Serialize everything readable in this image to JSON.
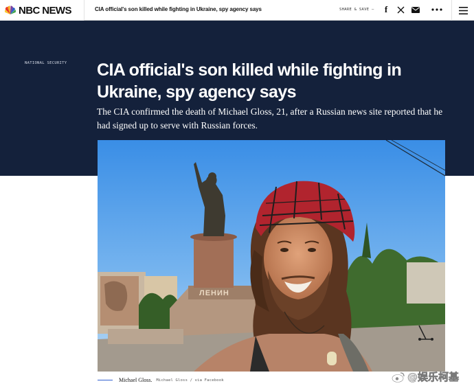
{
  "nav": {
    "logo_text": "NBC NEWS",
    "headline": "CIA official's son killed while fighting in Ukraine, spy agency says",
    "share_label": "SHARE & SAVE —",
    "icons": [
      "facebook-icon",
      "x-icon",
      "mail-icon",
      "more-icon",
      "menu-icon"
    ]
  },
  "article": {
    "section": "NATIONAL SECURITY",
    "headline": "CIA official's son killed while fighting in Ukraine, spy agency says",
    "dek": "The CIA confirmed the death of Michael Gloss, 21, after a Russian news site reported that he had signed up to serve with Russian forces."
  },
  "photo": {
    "monument_inscription": "ЛЕНИН",
    "caption": "Michael Gloss.",
    "credit": "Michael Gloss / via Facebook"
  },
  "watermark": "@娱乐柯基",
  "colors": {
    "hero_bg": "#14213b",
    "caption_rule": "#3060d0"
  }
}
